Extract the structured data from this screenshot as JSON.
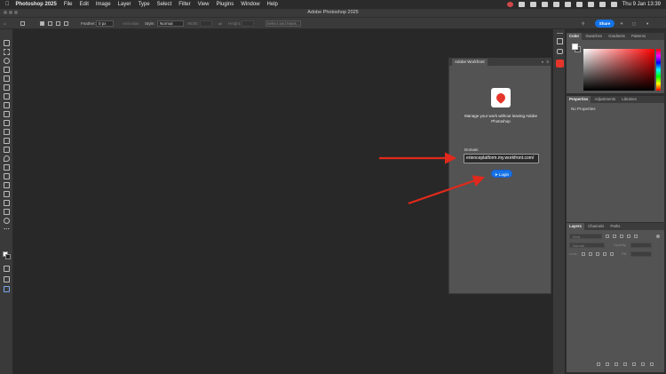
{
  "menubar": {
    "app": "Photoshop 2025",
    "items": [
      "File",
      "Edit",
      "Image",
      "Layer",
      "Type",
      "Select",
      "Filter",
      "View",
      "Plugins",
      "Window",
      "Help"
    ],
    "datetime": "Thu 9 Jan  13:39"
  },
  "window": {
    "title": "Adobe Photoshop 2025"
  },
  "options": {
    "feather_label": "Feather:",
    "feather_value": "0 px",
    "antialias_label": "Anti-alias",
    "style_label": "Style:",
    "style_value": "Normal",
    "width_label": "Width:",
    "height_label": "Height:",
    "select_mask": "Select and Mask...",
    "share": "Share"
  },
  "workfront": {
    "panel_title": "Adobe Workfront",
    "tagline": "Manage your work without leaving Adobe Photoshop",
    "domain_label": "Domain",
    "domain_value": "erienceplatform.my.workfront.com/",
    "login_label": "Login"
  },
  "panels": {
    "color_tabs": [
      "Color",
      "Swatches",
      "Gradients",
      "Patterns"
    ],
    "properties_tabs": [
      "Properties",
      "Adjustments",
      "Libraries"
    ],
    "no_properties": "No Properties",
    "layers_tabs": [
      "Layers",
      "Channels",
      "Paths"
    ],
    "layers_kind": "Kind",
    "layers_blend": "Normal",
    "layers_opacity": "Opacity:",
    "layers_lock": "Lock:",
    "layers_fill": "Fill:"
  },
  "colors": {
    "accent": "#1473e6",
    "arrow": "#e0291c",
    "workfront_red": "#e5352b"
  }
}
